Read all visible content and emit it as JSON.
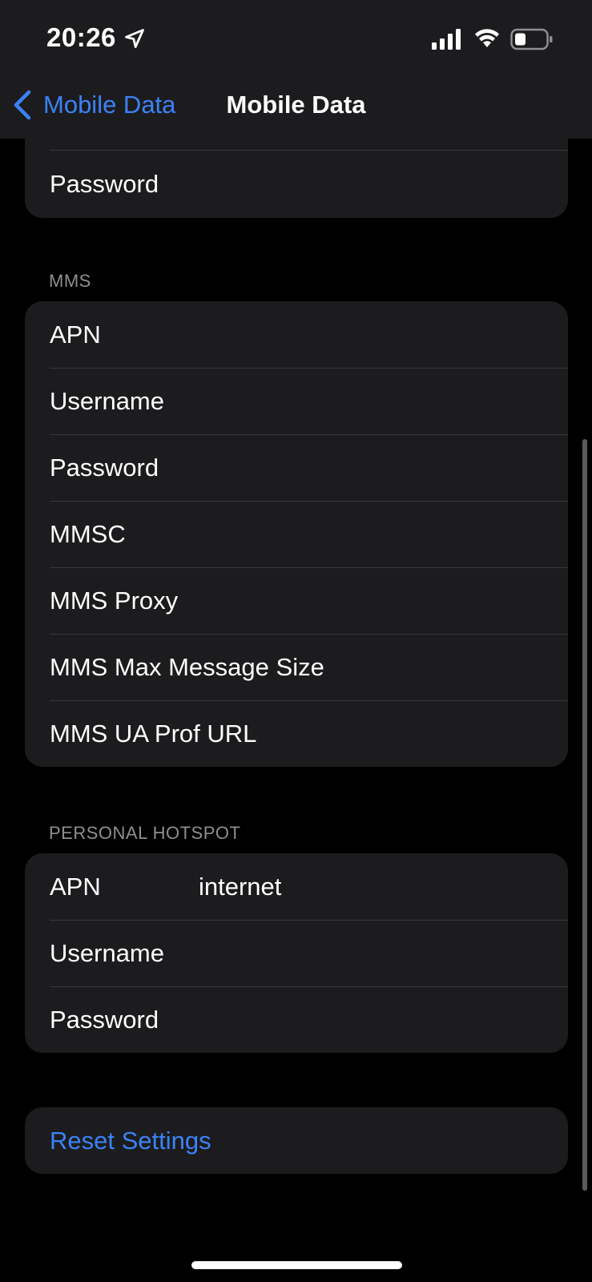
{
  "status_bar": {
    "time": "20:26",
    "icons": [
      "location-arrow-icon",
      "cellular-signal-icon",
      "wifi-icon",
      "battery-icon"
    ]
  },
  "nav": {
    "back_label": "Mobile Data",
    "title": "Mobile Data"
  },
  "top_group": {
    "rows": [
      {
        "label": "Password"
      }
    ]
  },
  "mms": {
    "header": "MMS",
    "rows": [
      {
        "label": "APN"
      },
      {
        "label": "Username"
      },
      {
        "label": "Password"
      },
      {
        "label": "MMSC"
      },
      {
        "label": "MMS Proxy"
      },
      {
        "label": "MMS Max Message Size"
      },
      {
        "label": "MMS UA Prof URL"
      }
    ]
  },
  "hotspot": {
    "header": "PERSONAL HOTSPOT",
    "rows": [
      {
        "label": "APN",
        "value": "internet"
      },
      {
        "label": "Username"
      },
      {
        "label": "Password"
      }
    ]
  },
  "reset": {
    "label": "Reset Settings"
  },
  "colors": {
    "accent": "#3b82f6",
    "group_bg": "#1c1c1e",
    "background": "#000000",
    "header_text": "#8e8e93"
  }
}
